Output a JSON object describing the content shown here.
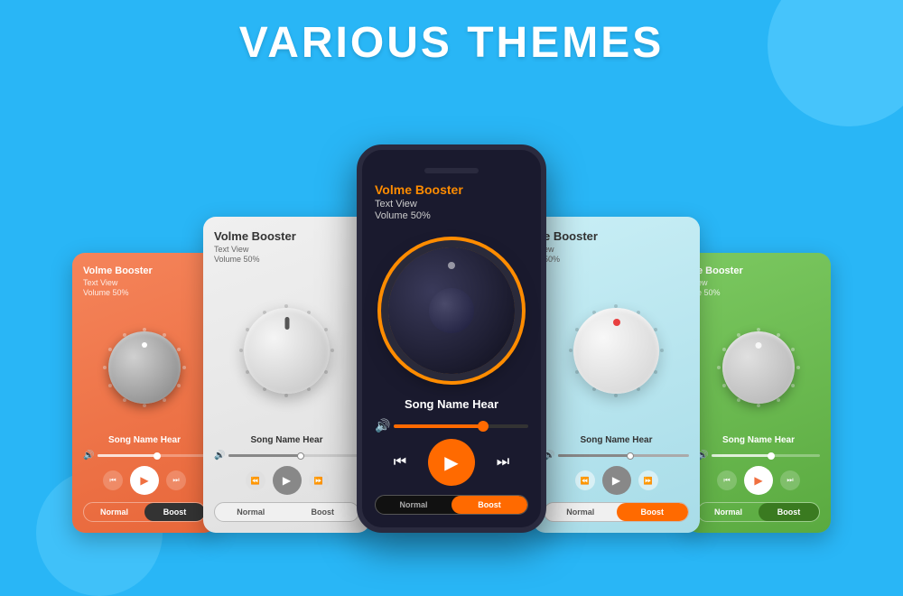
{
  "page": {
    "title": "VARIOUS THEMES",
    "background_color": "#29b6f6"
  },
  "cards": [
    {
      "id": "card-1",
      "theme": "orange",
      "title": "Volme Booster",
      "subtitle": "Text View",
      "volume_label": "Volume 50%",
      "song_name": "Song Name Hear",
      "normal_label": "Normal",
      "boost_label": "Boost",
      "active_mode": "boost"
    },
    {
      "id": "card-2",
      "theme": "gray",
      "title": "Volme Booster",
      "subtitle": "Text View",
      "volume_label": "Volume 50%",
      "song_name": "Song Name Hear",
      "normal_label": "Normal",
      "boost_label": "Boost",
      "active_mode": "normal"
    },
    {
      "id": "card-phone",
      "theme": "dark",
      "title": "Volme Booster",
      "subtitle": "Text View",
      "volume_label": "Volume 50%",
      "song_name": "Song Name Hear",
      "normal_label": "Normal",
      "boost_label": "Boost",
      "active_mode": "boost"
    },
    {
      "id": "card-4",
      "theme": "blue",
      "title": "e Booster",
      "subtitle": "ew",
      "volume_label": "50%",
      "song_name": "Song Name Hear",
      "normal_label": "Normal",
      "boost_label": "Boost",
      "active_mode": "boost"
    },
    {
      "id": "card-5",
      "theme": "green",
      "title": "e Booster",
      "subtitle": "ew",
      "volume_label": "e 50%",
      "song_name": "Song Name Hear",
      "normal_label": "Normal",
      "boost_label": "Boost",
      "active_mode": "boost"
    }
  ],
  "icons": {
    "prev": "⏮",
    "rewind": "⏪",
    "play": "▶",
    "forward": "⏩",
    "next": "⏭",
    "volume": "🔊"
  }
}
